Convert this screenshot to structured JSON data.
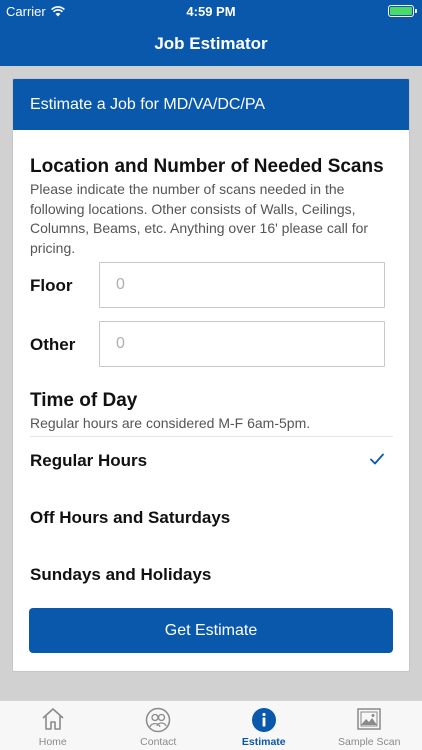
{
  "status": {
    "carrier": "Carrier",
    "time": "4:59 PM"
  },
  "nav": {
    "title": "Job Estimator"
  },
  "card": {
    "header": "Estimate a Job for MD/VA/DC/PA",
    "scans": {
      "title": "Location and Number of Needed Scans",
      "help": "Please indicate the number of scans needed in the following locations. Other consists of Walls, Ceilings, Columns, Beams, etc. Anything over 16' please call for pricing.",
      "fields": [
        {
          "label": "Floor",
          "placeholder": "0"
        },
        {
          "label": "Other",
          "placeholder": "0"
        }
      ]
    },
    "time_of_day": {
      "title": "Time of Day",
      "help": "Regular hours are considered M-F 6am-5pm.",
      "options": [
        {
          "label": "Regular Hours",
          "selected": true
        },
        {
          "label": "Off Hours and Saturdays",
          "selected": false
        },
        {
          "label": "Sundays and Holidays",
          "selected": false
        }
      ]
    },
    "button": "Get Estimate"
  },
  "tabs": [
    {
      "label": "Home",
      "icon": "home-icon",
      "active": false
    },
    {
      "label": "Contact",
      "icon": "contact-icon",
      "active": false
    },
    {
      "label": "Estimate",
      "icon": "info-icon",
      "active": true
    },
    {
      "label": "Sample Scan",
      "icon": "image-icon",
      "active": false
    }
  ],
  "colors": {
    "brand": "#0a58ab",
    "inactive": "#8a8a8a",
    "battery": "#4cd964"
  }
}
